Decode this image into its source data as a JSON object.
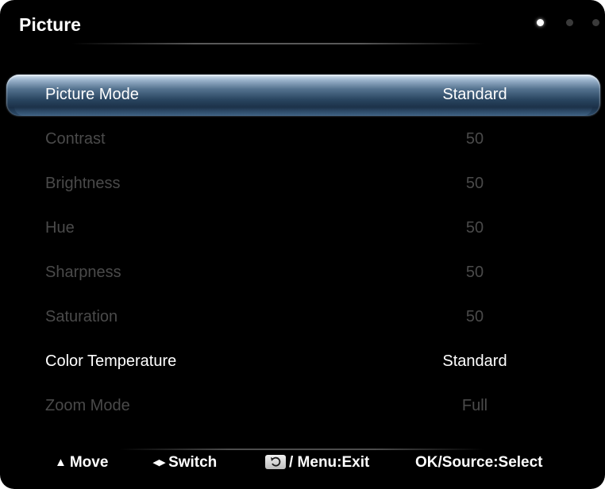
{
  "menu": {
    "title": "Picture",
    "page_indicator": {
      "total": 3,
      "current": 1
    },
    "items": [
      {
        "label": "Picture Mode",
        "value": "Standard",
        "selected": true,
        "enabled": true
      },
      {
        "label": "Contrast",
        "value": "50",
        "selected": false,
        "enabled": false
      },
      {
        "label": "Brightness",
        "value": "50",
        "selected": false,
        "enabled": false
      },
      {
        "label": "Hue",
        "value": "50",
        "selected": false,
        "enabled": false
      },
      {
        "label": "Sharpness",
        "value": "50",
        "selected": false,
        "enabled": false
      },
      {
        "label": "Saturation",
        "value": "50",
        "selected": false,
        "enabled": false
      },
      {
        "label": "Color Temperature",
        "value": "Standard",
        "selected": false,
        "enabled": true
      },
      {
        "label": "Zoom Mode",
        "value": "Full",
        "selected": false,
        "enabled": false
      }
    ]
  },
  "footer": {
    "move": {
      "icon": "up-down-arrows-icon",
      "label": "Move"
    },
    "switch": {
      "icon": "left-right-arrows-icon",
      "label": "Switch"
    },
    "exit": {
      "icon": "return-key-icon",
      "label": "/ Menu:Exit"
    },
    "select": {
      "label": "OK/Source:Select"
    }
  },
  "colors": {
    "background": "#000000",
    "text_enabled": "#ffffff",
    "text_disabled": "#4a4a4a",
    "highlight": "#2a4661"
  }
}
